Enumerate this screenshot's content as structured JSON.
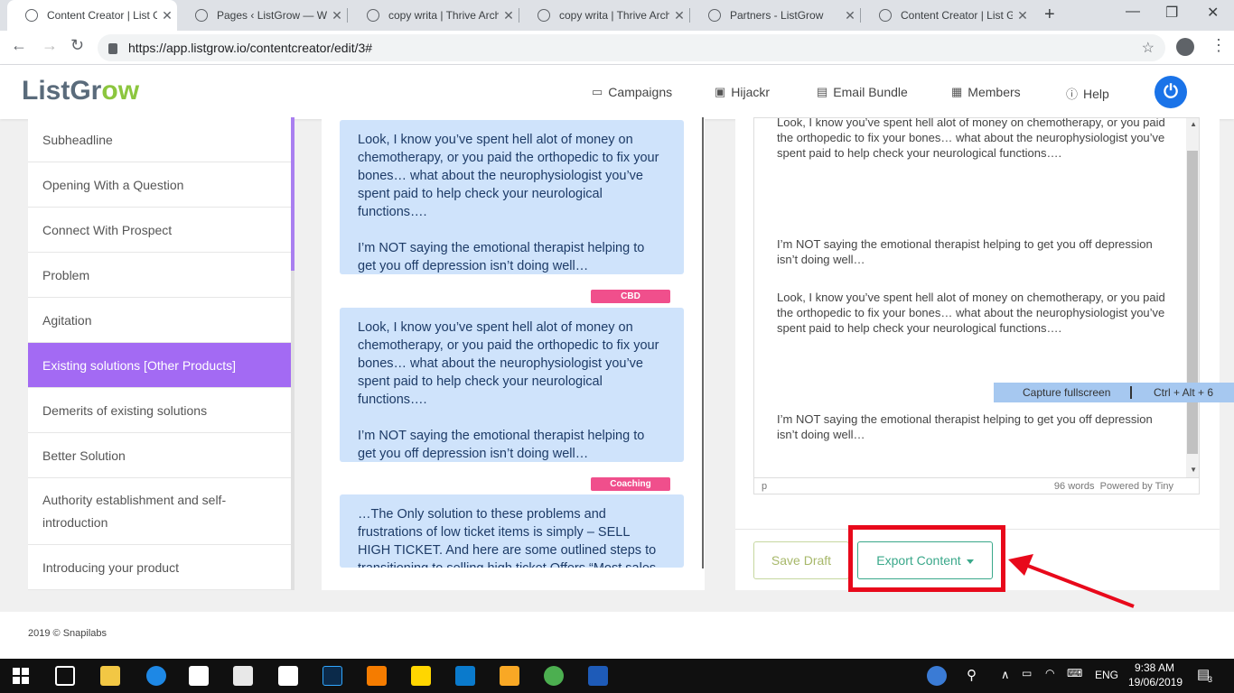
{
  "browser": {
    "tabs": [
      {
        "title": "Content Creator | List G",
        "active": true
      },
      {
        "title": "Pages ‹ ListGrow — Wo",
        "active": false
      },
      {
        "title": "copy writa | Thrive Arch",
        "active": false
      },
      {
        "title": "copy writa | Thrive Arch",
        "active": false
      },
      {
        "title": "Partners - ListGrow",
        "active": false
      },
      {
        "title": "Content Creator | List G",
        "active": false
      }
    ],
    "url": "https://app.listgrow.io/contentcreator/edit/3#"
  },
  "header": {
    "logo_part1": "ListGr",
    "logo_part2": "o",
    "logo_part3": "w",
    "nav": [
      "Campaigns",
      "Hijackr",
      "Email Bundle",
      "Members",
      "Help"
    ]
  },
  "sidebar": {
    "items": [
      "Subheadline",
      "Opening With a Question",
      "Connect With Prospect",
      "Problem",
      "Agitation",
      "Existing solutions [Other Products]",
      "Demerits of existing solutions",
      "Better Solution",
      "Authority establishment and self-introduction",
      "Introducing your product"
    ],
    "active_index": 5
  },
  "middle": {
    "cards": [
      {
        "p1": "Look, I know you’ve spent hell alot of money on chemotherapy, or you paid the orthopedic to fix your bones… what about the neurophysiologist you’ve spent paid to help check your neurological functions….",
        "p2": "I’m NOT saying the emotional therapist helping to get you off depression isn’t doing well…"
      },
      {
        "tag": "CBD",
        "p1": "Look, I know you’ve spent hell alot of money on chemotherapy, or you paid the orthopedic to fix your bones… what about the neurophysiologist you’ve spent paid to help check your neurological functions….",
        "p2": "I’m NOT saying the emotional therapist helping to get you off depression isn’t doing well…"
      },
      {
        "tag": "Coaching",
        "p1": "…The Only solution to these problems and frustrations of low ticket items is simply – SELL HIGH TICKET. And here are some outlined steps to transitioning to selling high ticket Offers “Most sales"
      }
    ]
  },
  "editor": {
    "paragraphs": [
      "Look, I know you’ve spent hell alot of money on chemotherapy, or you paid the orthopedic to fix your bones… what about the neurophysiologist you’ve spent paid to help check your neurological functions….",
      "I’m NOT saying the emotional therapist helping to get you off depression isn’t doing well…",
      "Look, I know you’ve spent hell alot of money on chemotherapy, or you paid the orthopedic to fix your bones… what about the neurophysiologist you’ve spent paid to help check your neurological functions….",
      "I’m NOT saying the emotional therapist helping to get you off depression isn’t doing well…"
    ],
    "status_path": "p",
    "word_count": "96 words",
    "powered_by": "Powered by Tiny"
  },
  "actions": {
    "save_label": "Save Draft",
    "export_label": "Export Content"
  },
  "tooltip": {
    "label": "Capture fullscreen",
    "shortcut": "Ctrl + Alt + 6"
  },
  "footer": {
    "text": "2019 © Snapilabs"
  },
  "taskbar": {
    "lang": "ENG",
    "time": "9:38 AM",
    "date": "19/06/2019",
    "notifications": "3"
  },
  "colors": {
    "accent_purple": "#a36af3",
    "card_blue": "#cfe3fb",
    "tag_pink": "#f04f8c",
    "export_green": "#3aa88a",
    "annotation_red": "#e8091b"
  }
}
